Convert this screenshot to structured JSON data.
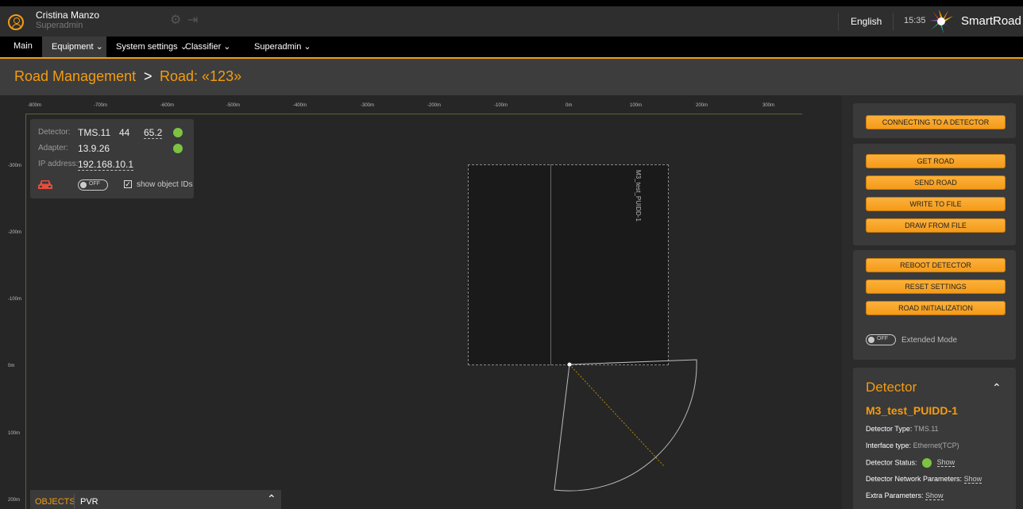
{
  "header": {
    "user_name": "Cristina Manzo",
    "user_role": "Superadmin",
    "language": "English",
    "time": "15:35",
    "brand": "SmartRoad"
  },
  "nav": {
    "items": [
      {
        "label": "Main"
      },
      {
        "label": "Equipment ⌄"
      },
      {
        "label": "System settings ⌄"
      },
      {
        "label": "Classifier ⌄"
      },
      {
        "label": "Superadmin ⌄"
      }
    ]
  },
  "breadcrumb": {
    "parent": "Road Management",
    "separator": ">",
    "current": "Road: «123»"
  },
  "ruler": {
    "x_labels": [
      "-800m",
      "-700m",
      "-600m",
      "-500m",
      "-400m",
      "-300m",
      "-200m",
      "-100m",
      "0m",
      "100m",
      "200m",
      "300m"
    ],
    "y_labels": [
      "-300m",
      "-200m",
      "-100m",
      "0m",
      "100m",
      "200m"
    ]
  },
  "detector_panel": {
    "detector_label": "Detector:",
    "detector_type": "TMS.11",
    "detector_num": "44",
    "detector_value": "65.2",
    "adapter_label": "Adapter:",
    "adapter_value": "13.9.26",
    "ip_label": "IP address:",
    "ip_value": "192.168.10.1",
    "toggle_text": "OFF",
    "show_ids_label": "show object IDs",
    "status_color": "#7dc242"
  },
  "road": {
    "label": "M3_test_PUIDD-1"
  },
  "bottom_tabs": {
    "objects": "OBJECTS",
    "pvr": "PVR"
  },
  "side_buttons": {
    "connect": "CONNECTING TO A DETECTOR",
    "get_road": "GET ROAD",
    "send_road": "SEND ROAD",
    "write_file": "WRITE TO FILE",
    "draw_file": "DRAW FROM FILE",
    "reboot": "REBOOT DETECTOR",
    "reset": "RESET SETTINGS",
    "road_init": "ROAD INITIALIZATION",
    "extended_toggle": "OFF",
    "extended_label": "Extended Mode"
  },
  "detector_card": {
    "title": "Detector",
    "name": "M3_test_PUIDD-1",
    "type_label": "Detector Type:",
    "type_value": "TMS.11",
    "interface_label": "Interface type:",
    "interface_value": "Ethernet(TCP)",
    "status_label": "Detector Status:",
    "network_label": "Detector Network Parameters:",
    "extra_label": "Extra Parameters:",
    "show": "Show"
  },
  "colors": {
    "accent": "#f39c12",
    "status_green": "#7dc242"
  }
}
